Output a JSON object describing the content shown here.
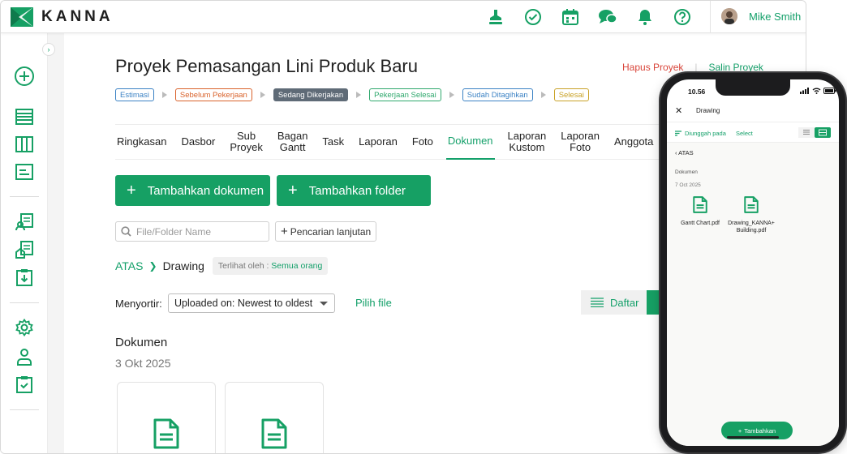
{
  "app": {
    "brand": "KANNA",
    "user_name": "Mike Smith"
  },
  "topbar_icons": [
    "stamp-icon",
    "check-circle-icon",
    "calendar-icon",
    "chat-icon",
    "bell-icon",
    "help-icon"
  ],
  "project": {
    "title": "Proyek Pemasangan Lini Produk Baru",
    "delete_label": "Hapus Proyek",
    "copy_label": "Salin Proyek",
    "statuses": [
      {
        "label": "Estimasi",
        "color": "#3b82c4"
      },
      {
        "label": "Sebelum Pekerjaan",
        "color": "#d9622b"
      },
      {
        "label": "Sedang Dikerjakan",
        "color": "#5f6b77",
        "active": true
      },
      {
        "label": "Pekerjaan Selesai",
        "color": "#2fa86d"
      },
      {
        "label": "Sudah Ditagihkan",
        "color": "#3b82c4"
      },
      {
        "label": "Selesai",
        "color": "#c9a227"
      }
    ]
  },
  "tabs": [
    {
      "label": "Ringkasan"
    },
    {
      "label": "Dasbor"
    },
    {
      "label": "Sub\nProyek"
    },
    {
      "label": "Bagan\nGantt"
    },
    {
      "label": "Task"
    },
    {
      "label": "Laporan"
    },
    {
      "label": "Foto"
    },
    {
      "label": "Dokumen",
      "active": true
    },
    {
      "label": "Laporan\nKustom"
    },
    {
      "label": "Laporan\nFoto"
    },
    {
      "label": "Anggota"
    }
  ],
  "actions": {
    "add_document": "Tambahkan dokumen",
    "add_folder": "Tambahkan folder"
  },
  "search": {
    "placeholder": "File/Folder Name",
    "advanced_label": "Pencarian lanjutan"
  },
  "breadcrumb": {
    "root": "ATAS",
    "current": "Drawing",
    "visibility_label": "Terlihat oleh :",
    "visibility_value": "Semua orang"
  },
  "sort": {
    "label": "Menyortir:",
    "selected": "Uploaded on: Newest to oldest",
    "pick_file": "Pilih file"
  },
  "view": {
    "list_label": "Daftar"
  },
  "documents": {
    "section_title": "Dokumen",
    "date": "3 Okt 2025"
  },
  "colors": {
    "accent": "#16a064",
    "accent_text": "#14a06a",
    "danger": "#d9453a"
  },
  "phone": {
    "time": "10.56",
    "title": "Drawing",
    "upload_label": "Diunggah pada",
    "select_label": "Select",
    "back_label": "ATAS",
    "section_title": "Dokumen",
    "date": "7 Oct 2025",
    "files": [
      {
        "name": "Gantt Chart.pdf"
      },
      {
        "name": "Drawing_KANNA+Building.pdf"
      }
    ],
    "add_label": "Tambahkan"
  }
}
